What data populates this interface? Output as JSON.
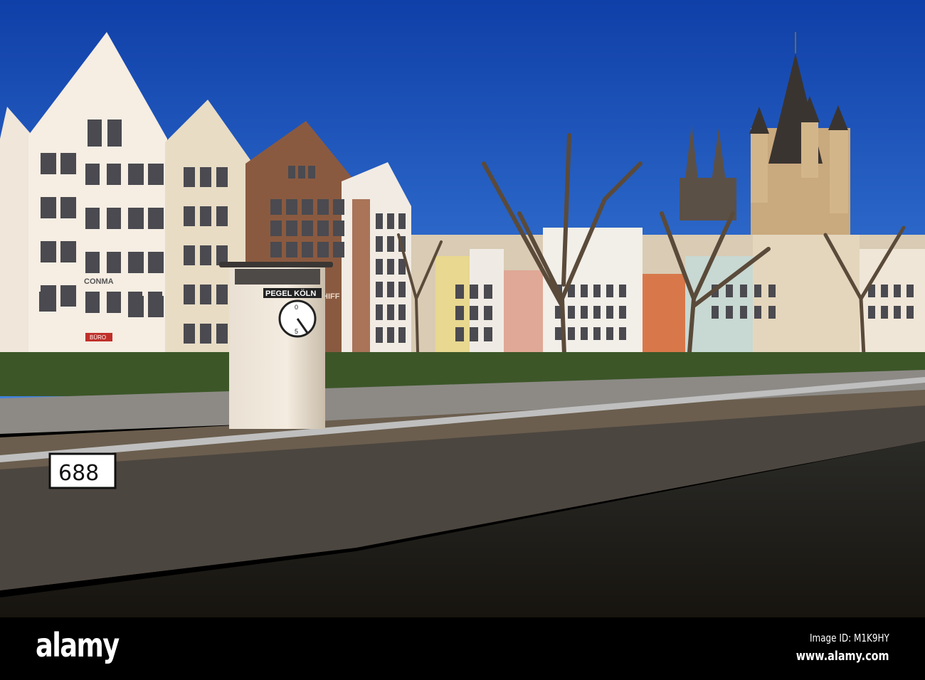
{
  "photo": {
    "signs": {
      "gauge_tower": "PEGEL KÖLN",
      "partial_sign": "HIFF",
      "building_name": "CONMA",
      "shop_sign": "BÜRO",
      "river_km": "688"
    },
    "gauge_clock": {
      "top": "0",
      "bottom": "5"
    }
  },
  "footer": {
    "logo": "alamy",
    "image_id": "Image ID: M1K9HY",
    "website": "www.alamy.com"
  }
}
